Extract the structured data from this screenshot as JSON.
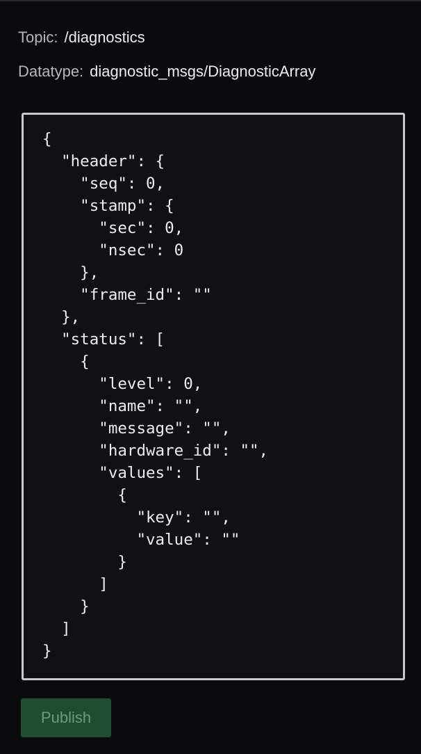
{
  "topic": {
    "label": "Topic:",
    "value": "/diagnostics"
  },
  "datatype": {
    "label": "Datatype:",
    "value": "diagnostic_msgs/DiagnosticArray"
  },
  "editor": {
    "content": "{\n  \"header\": {\n    \"seq\": 0,\n    \"stamp\": {\n      \"sec\": 0,\n      \"nsec\": 0\n    },\n    \"frame_id\": \"\"\n  },\n  \"status\": [\n    {\n      \"level\": 0,\n      \"name\": \"\",\n      \"message\": \"\",\n      \"hardware_id\": \"\",\n      \"values\": [\n        {\n          \"key\": \"\",\n          \"value\": \"\"\n        }\n      ]\n    }\n  ]\n}"
  },
  "publish": {
    "label": "Publish",
    "enabled": false
  },
  "colors": {
    "background": "#0b0b0d",
    "editor_background": "#111115",
    "editor_border": "#c9c9cf",
    "button_background": "#1e4d31",
    "button_text": "#6f9a80"
  }
}
